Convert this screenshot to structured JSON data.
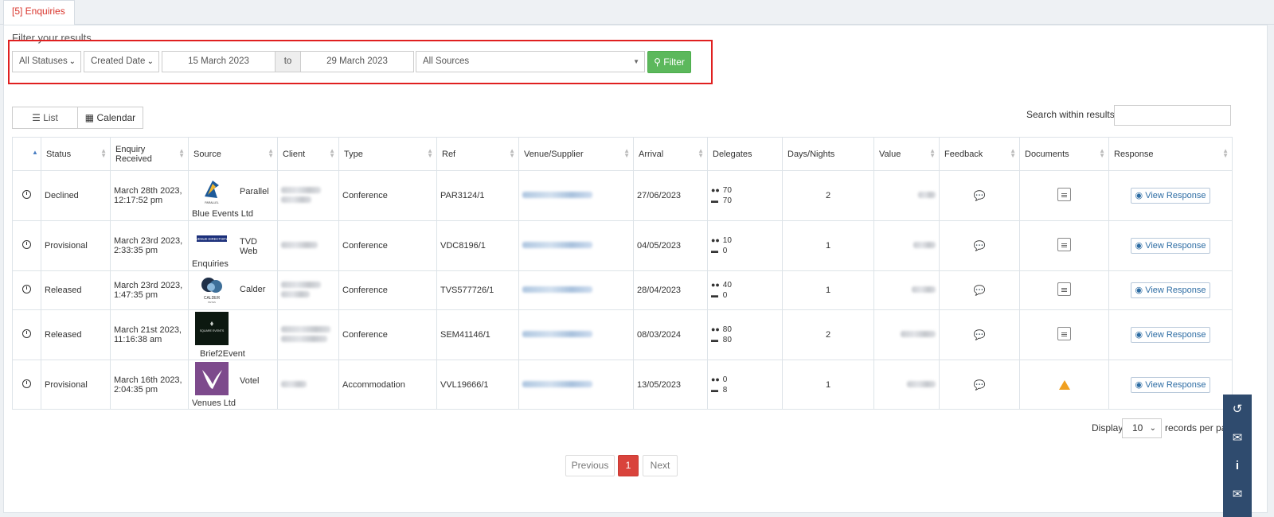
{
  "tab": {
    "label": "[5] Enquiries"
  },
  "filter": {
    "title": "Filter your results",
    "status": "All Statuses",
    "date_type": "Created Date",
    "date_from": "15 March 2023",
    "to_label": "to",
    "date_to": "29 March 2023",
    "source": "All Sources",
    "button": "Filter"
  },
  "views": {
    "list": "List",
    "calendar": "Calendar"
  },
  "search": {
    "label": "Search within results"
  },
  "columns": {
    "status": "Status",
    "received": "Enquiry Received",
    "source": "Source",
    "client": "Client",
    "type": "Type",
    "ref": "Ref",
    "venue": "Venue/Supplier",
    "arrival": "Arrival",
    "delegates": "Delegates",
    "days": "Days/Nights",
    "value": "Value",
    "feedback": "Feedback",
    "documents": "Documents",
    "response": "Response"
  },
  "rows": [
    {
      "status": "Declined",
      "received": "March 28th 2023, 12:17:52 pm",
      "source_a": "Parallel",
      "source_b": "Blue Events Ltd",
      "type": "Conference",
      "ref": "PAR3124/1",
      "arrival": "27/06/2023",
      "del_people": "70",
      "del_rooms": "70",
      "days": "2",
      "response": "View Response"
    },
    {
      "status": "Provisional",
      "received": "March 23rd 2023, 2:33:35 pm",
      "source_a": "TVD Web",
      "source_b": "Enquiries",
      "type": "Conference",
      "ref": "VDC8196/1",
      "arrival": "04/05/2023",
      "del_people": "10",
      "del_rooms": "0",
      "days": "1",
      "response": "View Response"
    },
    {
      "status": "Released",
      "received": "March 23rd 2023, 1:47:35 pm",
      "source_a": "Calder",
      "source_b": "",
      "type": "Conference",
      "ref": "TVS577726/1",
      "arrival": "28/04/2023",
      "del_people": "40",
      "del_rooms": "0",
      "days": "1",
      "response": "View Response"
    },
    {
      "status": "Released",
      "received": "March 21st 2023, 11:16:38 am",
      "source_a": "",
      "source_b": "Brief2Event",
      "type": "Conference",
      "ref": "SEM41146/1",
      "arrival": "08/03/2024",
      "del_people": "80",
      "del_rooms": "80",
      "days": "2",
      "response": "View Response"
    },
    {
      "status": "Provisional",
      "received": "March 16th 2023, 2:04:35 pm",
      "source_a": "Votel",
      "source_b": "Venues Ltd",
      "type": "Accommodation",
      "ref": "VVL19666/1",
      "arrival": "13/05/2023",
      "del_people": "0",
      "del_rooms": "8",
      "days": "1",
      "response": "View Response"
    }
  ],
  "logos": {
    "parallel": "PARALLEL",
    "venue_directory": "VENUE DIRECTORY",
    "calder": "CALDER",
    "calder_sub": "PETES",
    "square": "SQUARE EVENTS"
  },
  "paging": {
    "display": "Display",
    "per_page": "10",
    "records": "records per pa",
    "previous": "Previous",
    "page": "1",
    "next": "Next"
  },
  "colors": {
    "accent": "#d9433c",
    "filter_green": "#5cb85c",
    "link_blue": "#2e6da4",
    "sidebar": "#2f4b6e"
  }
}
